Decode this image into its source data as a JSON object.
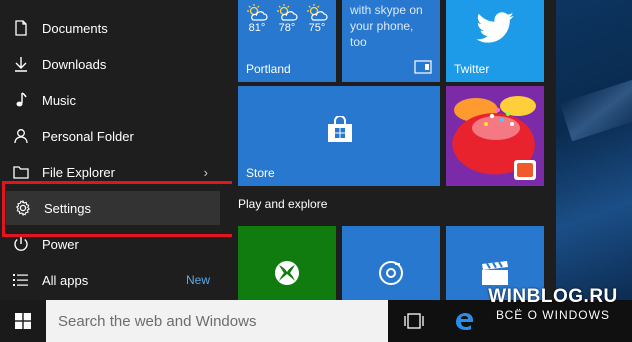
{
  "menu": {
    "items": [
      {
        "label": "Documents",
        "icon": "document-icon"
      },
      {
        "label": "Downloads",
        "icon": "download-icon"
      },
      {
        "label": "Music",
        "icon": "music-icon"
      },
      {
        "label": "Personal Folder",
        "icon": "person-icon"
      },
      {
        "label": "File Explorer",
        "icon": "folder-icon"
      },
      {
        "label": "Settings",
        "icon": "gear-icon"
      },
      {
        "label": "Power",
        "icon": "power-icon"
      },
      {
        "label": "All apps",
        "icon": "list-icon"
      }
    ],
    "all_apps_badge": "New",
    "highlight_color": "#e3141d"
  },
  "tiles": {
    "weather": {
      "city": "Portland",
      "temps": [
        "81°",
        "78°",
        "75°"
      ]
    },
    "skype": {
      "line1": "with skype on",
      "line2": "your phone,",
      "line3": "too"
    },
    "twitter": {
      "label": "Twitter"
    },
    "store": {
      "label": "Store"
    },
    "section_label": "Play and explore"
  },
  "taskbar": {
    "search_placeholder": "Search the web and Windows"
  },
  "watermark": {
    "line1": "WINBLOG.RU",
    "line2": "ВСЁ О WINDOWS"
  }
}
